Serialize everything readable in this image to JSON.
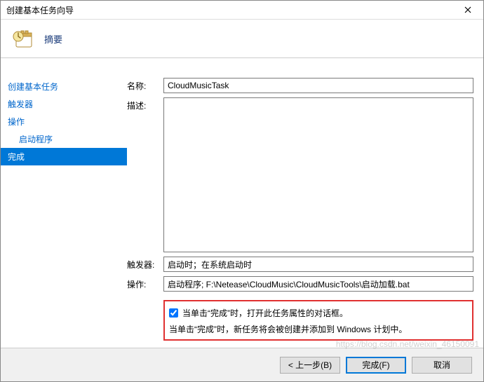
{
  "window": {
    "title": "创建基本任务向导"
  },
  "header": {
    "title": "摘要"
  },
  "nav": {
    "items": [
      {
        "label": "创建基本任务",
        "indent": false,
        "selected": false
      },
      {
        "label": "触发器",
        "indent": false,
        "selected": false
      },
      {
        "label": "操作",
        "indent": false,
        "selected": false
      },
      {
        "label": "启动程序",
        "indent": true,
        "selected": false
      },
      {
        "label": "完成",
        "indent": false,
        "selected": true
      }
    ]
  },
  "form": {
    "name_label": "名称:",
    "name_value": "CloudMusicTask",
    "desc_label": "描述:",
    "desc_value": "",
    "trigger_label": "触发器:",
    "trigger_value": "启动时；在系统启动时",
    "action_label": "操作:",
    "action_value": "启动程序; F:\\Netease\\CloudMusic\\CloudMusicTools\\启动加载.bat",
    "open_props_checked": true,
    "open_props_label": "当单击“完成”时，打开此任务属性的对话框。",
    "info_text": "当单击“完成”时，新任务将会被创建并添加到 Windows 计划中。"
  },
  "footer": {
    "back": "< 上一步(B)",
    "finish": "完成(F)",
    "cancel": "取消"
  },
  "watermark": "https://blog.csdn.net/weixin_46150091"
}
